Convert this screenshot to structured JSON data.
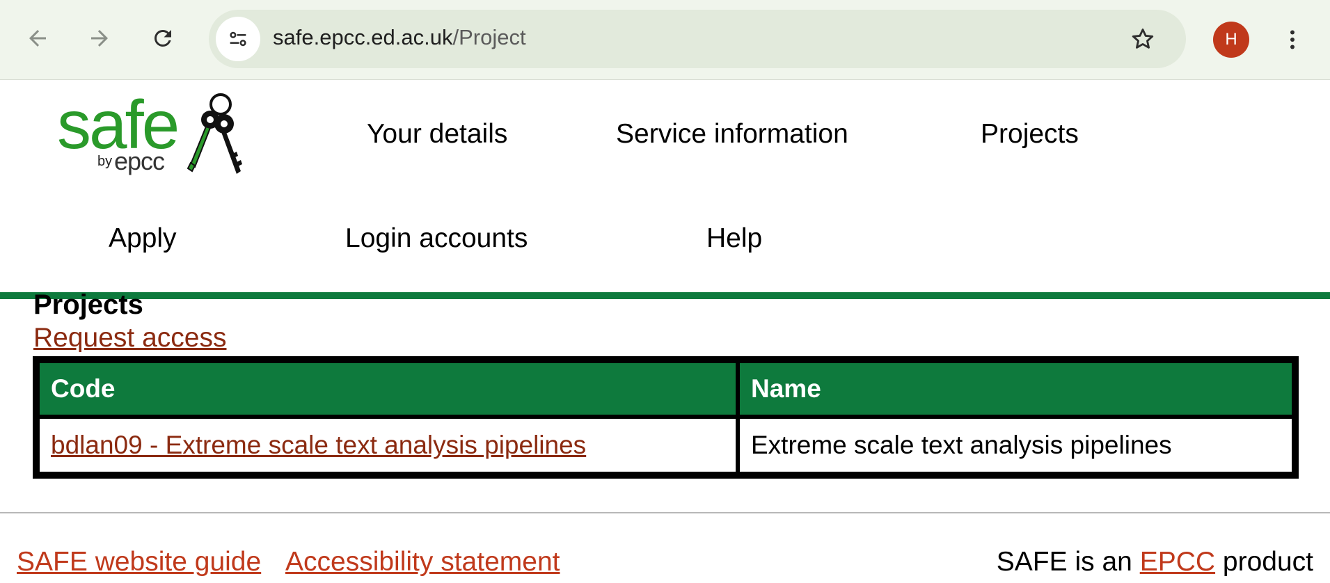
{
  "browser": {
    "url_host": "safe.epcc.ed.ac.uk",
    "url_path": "/Project",
    "profile_initial": "H",
    "icons": [
      "back-arrow-icon",
      "forward-arrow-icon",
      "reload-icon",
      "site-info-icon",
      "bookmark-star-icon",
      "more-menu-icon"
    ]
  },
  "logo": {
    "word": "safe",
    "by": "by",
    "org": "epcc"
  },
  "nav": {
    "your_details": "Your details",
    "service_information": "Service information",
    "projects": "Projects",
    "apply": "Apply",
    "login_accounts": "Login accounts",
    "help": "Help"
  },
  "main": {
    "title": "Projects",
    "request_access": "Request access",
    "table": {
      "headers": [
        "Code",
        "Name"
      ],
      "rows": [
        {
          "code": "bdlan09 - Extreme scale text analysis pipelines",
          "name": "Extreme scale text analysis pipelines"
        }
      ]
    }
  },
  "footer": {
    "guide": "SAFE website guide",
    "accessibility": "Accessibility statement",
    "product_prefix": "SAFE is an",
    "product_link": "EPCC",
    "product_suffix": "product"
  },
  "colors": {
    "brand_green": "#0e7a3d",
    "link_red": "#8b2a10",
    "footer_link": "#c0391b",
    "logo_green": "#2a9a2a"
  }
}
